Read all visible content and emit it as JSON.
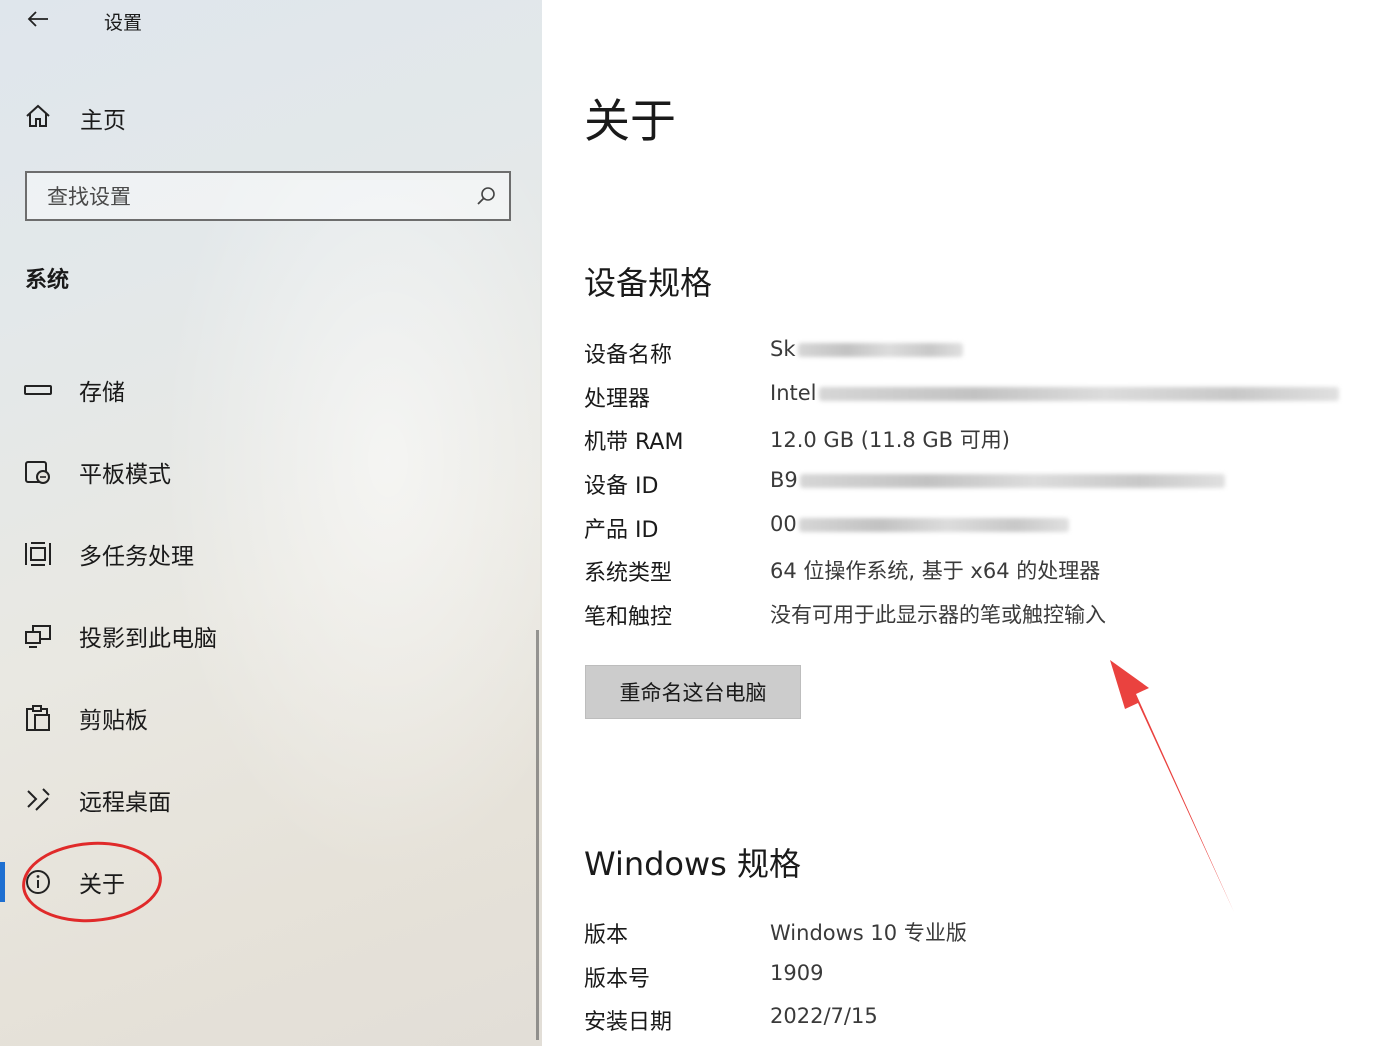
{
  "app": {
    "title": "设置"
  },
  "home": {
    "label": "主页"
  },
  "search": {
    "placeholder": "查找设置"
  },
  "section": {
    "title": "系统"
  },
  "nav": {
    "items": [
      {
        "label": "存储",
        "icon": "storage-icon"
      },
      {
        "label": "平板模式",
        "icon": "tablet-mode-icon"
      },
      {
        "label": "多任务处理",
        "icon": "multitasking-icon"
      },
      {
        "label": "投影到此电脑",
        "icon": "project-icon"
      },
      {
        "label": "剪贴板",
        "icon": "clipboard-icon"
      },
      {
        "label": "远程桌面",
        "icon": "remote-desktop-icon"
      },
      {
        "label": "关于",
        "icon": "info-icon",
        "active": true
      }
    ]
  },
  "main": {
    "title": "关于",
    "device_specs": {
      "heading": "设备规格",
      "rows": [
        {
          "key": "设备名称",
          "value": "Sk"
        },
        {
          "key": "处理器",
          "value": "Intel"
        },
        {
          "key": "机带 RAM",
          "value": "12.0 GB (11.8 GB 可用)"
        },
        {
          "key": "设备 ID",
          "value": "B9"
        },
        {
          "key": "产品 ID",
          "value": "00"
        },
        {
          "key": "系统类型",
          "value": "64 位操作系统, 基于 x64 的处理器"
        },
        {
          "key": "笔和触控",
          "value": "没有可用于此显示器的笔或触控输入"
        }
      ]
    },
    "rename_button": "重命名这台电脑",
    "windows_specs": {
      "heading": "Windows 规格",
      "rows": [
        {
          "key": "版本",
          "value": "Windows 10 专业版"
        },
        {
          "key": "版本号",
          "value": "1909"
        },
        {
          "key": "安装日期",
          "value": "2022/7/15"
        }
      ]
    }
  },
  "colors": {
    "accent": "#1e6fd1",
    "annotation": "#e02a2a"
  }
}
